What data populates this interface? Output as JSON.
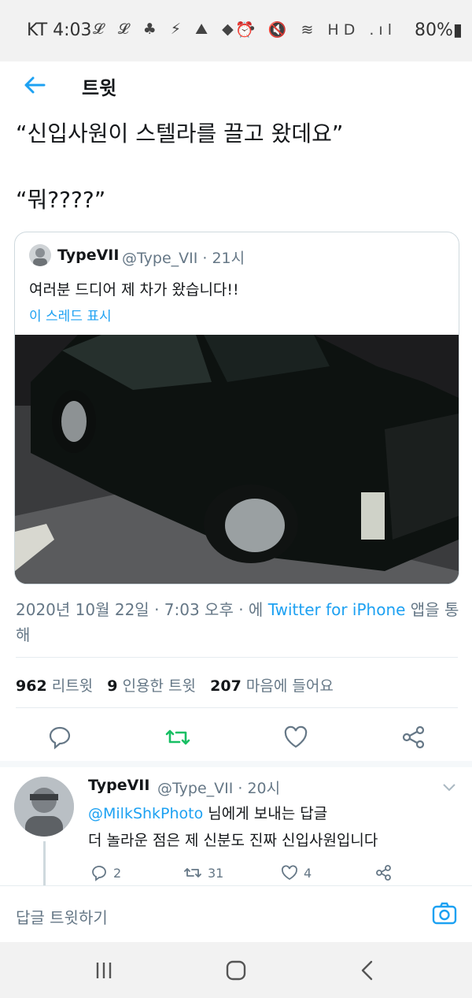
{
  "status": {
    "carrier_time": "KT 4:03",
    "left_icons": "𝓛 𝓛 ♣ ⚡ ⛰ ◆ •",
    "right_icons": "⏰ 🔇 ≋ HD .ıl",
    "battery": "80%▮"
  },
  "header": {
    "title": "트윗"
  },
  "tweet": {
    "line1": "“신입사원이 스텔라를 끌고 왔데요”",
    "line2": "“뭐????”"
  },
  "quote": {
    "name": "TypeVII",
    "handle": "@Type_VII · 21시",
    "text": "여러분 드디어 제 차가 왔습니다!!",
    "show_thread": "이 스레드 표시"
  },
  "meta": {
    "date": "2020년 10월 22일 · 7:03 오후 · 에 ",
    "source": "Twitter for iPhone",
    "suffix": " 앱을 통해"
  },
  "stats": {
    "retweets_count": "962",
    "retweets_label": "리트윗",
    "quotes_count": "9",
    "quotes_label": "인용한 트윗",
    "likes_count": "207",
    "likes_label": "마음에 들어요"
  },
  "reply": {
    "name": "TypeVII",
    "handle": "@Type_VII · 20시",
    "to_user": "@MilkShkPhoto",
    "to_suffix": " 님에게 보내는 답글",
    "text": "더 놀라운 점은 제 신분도 진짜 신입사원입니다",
    "replies": "2",
    "retweets": "31",
    "likes": "4"
  },
  "compose": {
    "placeholder": "답글 트윗하기"
  },
  "colors": {
    "accent": "#1da1f2",
    "retweet_green": "#17bf63",
    "muted": "#657786",
    "text": "#14171a"
  }
}
